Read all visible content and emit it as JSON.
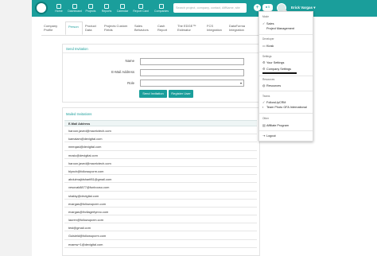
{
  "topbar": {
    "nav": [
      {
        "label": "Home",
        "icon": "home-icon"
      },
      {
        "label": "Dashboard",
        "icon": "dashboard-icon"
      },
      {
        "label": "Projects",
        "icon": "projects-icon"
      },
      {
        "label": "Reports",
        "icon": "reports-icon"
      },
      {
        "label": "Calendar",
        "icon": "calendar-icon"
      },
      {
        "label": "Report Card",
        "icon": "report-card-icon"
      },
      {
        "label": "Companies",
        "icon": "companies-icon"
      }
    ],
    "search_placeholder": "Search project, company, contact, AffName, site",
    "plus": "+",
    "user_btn": "♣ 5",
    "user_name": "Erick Vargas ▾"
  },
  "tabs": [
    {
      "label": "Company Profile",
      "active": false
    },
    {
      "label": "Person",
      "active": true
    },
    {
      "label": "Product Data",
      "active": false
    },
    {
      "label": "Projects Custom Fields",
      "active": false
    },
    {
      "label": "Sales Behaviors",
      "active": false
    },
    {
      "label": "Cash Report",
      "active": false
    },
    {
      "label": "The EDGE™ Estimator",
      "active": false
    },
    {
      "label": "FCS Integration",
      "active": false
    },
    {
      "label": "DataForma Integration",
      "active": false
    }
  ],
  "invite_form": {
    "title": "Send Invitation",
    "name_label": "Name",
    "email_label": "E-Mail Address",
    "role_label": "Role",
    "send_button": "Send Invitation",
    "register_button": "Register User"
  },
  "mailed": {
    "title": "Mailed Invitations",
    "column": "E-Mail Address",
    "rows": [
      "haroon.javed@mavrictech.com",
      "kamalam@devigital.com",
      "meeqasi@devigital.com",
      "mosic@devigital.com",
      "haroon.javed@mavrictech.com",
      "blynch@followupcrm.com",
      "abdulmajidsharif81@gmail.com",
      "vesovak8877@funbooso.com",
      "shafay@devigital.com",
      "evargas@followupcrm.com",
      "evargas@lhvllagertynno.com",
      "lauren@followupcrm.com",
      "test@gmail.com",
      "Guisield@followupcrm.com",
      "examw+1@devigital.com"
    ]
  },
  "dropdown": {
    "mode_label": "Mode",
    "sales": "Sales",
    "project_management": "Project Management",
    "developer_label": "Developer",
    "kiosk": "Kiosk",
    "settings_label": "Settings",
    "your_settings": "Your Settings",
    "company_settings": "Company Settings",
    "resources_label": "Resources",
    "resources": "Resources",
    "teams_label": "Teams",
    "team1": "FollowUpCRM",
    "team2": "Team Photo GFA International",
    "other_label": "Other",
    "affiliate": "Affiliate Program",
    "logout": "Logout"
  }
}
